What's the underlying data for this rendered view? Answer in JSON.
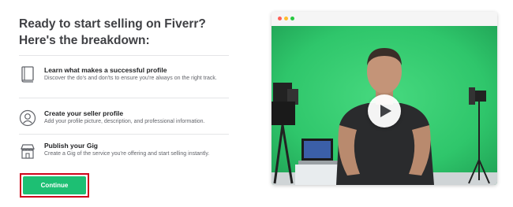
{
  "heading": "Ready to start selling on Fiverr? Here's the breakdown:",
  "steps": [
    {
      "icon": "book-icon",
      "title": "Learn what makes a successful profile",
      "description": "Discover the do's and don'ts to ensure you're always on the right track."
    },
    {
      "icon": "user-profile-icon",
      "title": "Create your seller profile",
      "description": "Add your profile picture, description, and professional information."
    },
    {
      "icon": "storefront-icon",
      "title": "Publish your Gig",
      "description": "Create a Gig of the service you're offering and start selling instantly."
    }
  ],
  "continue_label": "Continue",
  "video": {
    "window_controls": [
      "close-dot",
      "minimize-dot",
      "maximize-dot"
    ],
    "play_icon": "play-icon"
  },
  "colors": {
    "brand_green": "#1dbf73",
    "highlight_red": "#d0021b",
    "green_screen": "#2fc66b",
    "heading_text": "#404145"
  }
}
